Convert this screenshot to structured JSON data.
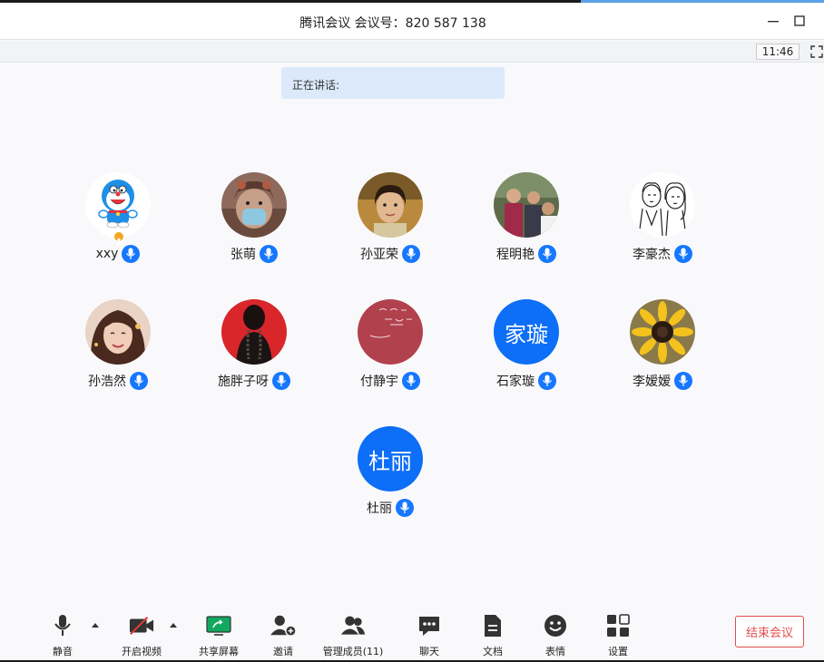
{
  "window": {
    "title": "腾讯会议 会议号：820 587 138",
    "clock": "11:46"
  },
  "speaking": {
    "label": "正在讲话:"
  },
  "participants": [
    {
      "name": "xxy",
      "avatar": "doraemon",
      "host": true
    },
    {
      "name": "张萌",
      "avatar": "photo-mask-girl"
    },
    {
      "name": "孙亚荣",
      "avatar": "photo-woman"
    },
    {
      "name": "程明艳",
      "avatar": "photo-group"
    },
    {
      "name": "李豪杰",
      "avatar": "sketch-couple"
    },
    {
      "name": "孙浩然",
      "avatar": "photo-woman-smile"
    },
    {
      "name": "施胖子呀",
      "avatar": "photo-red-braid"
    },
    {
      "name": "付静宇",
      "avatar": "red-card-text"
    },
    {
      "name": "石家璇",
      "avatar": "initials",
      "initials": "家璇"
    },
    {
      "name": "李嫒嫒",
      "avatar": "sunflower"
    },
    {
      "name": "杜丽",
      "avatar": "initials",
      "initials": "杜丽"
    }
  ],
  "toolbar": {
    "mute": "静音",
    "video": "开启视频",
    "share": "共享屏幕",
    "invite": "邀请",
    "members": "管理成员(11)",
    "chat": "聊天",
    "docs": "文档",
    "emoji": "表情",
    "settings": "设置",
    "end": "结束会议"
  },
  "colors": {
    "accent": "#1677ff",
    "share_green": "#12a861",
    "end_red": "#e34d4d",
    "speaking_bg": "#dbe9fb"
  }
}
